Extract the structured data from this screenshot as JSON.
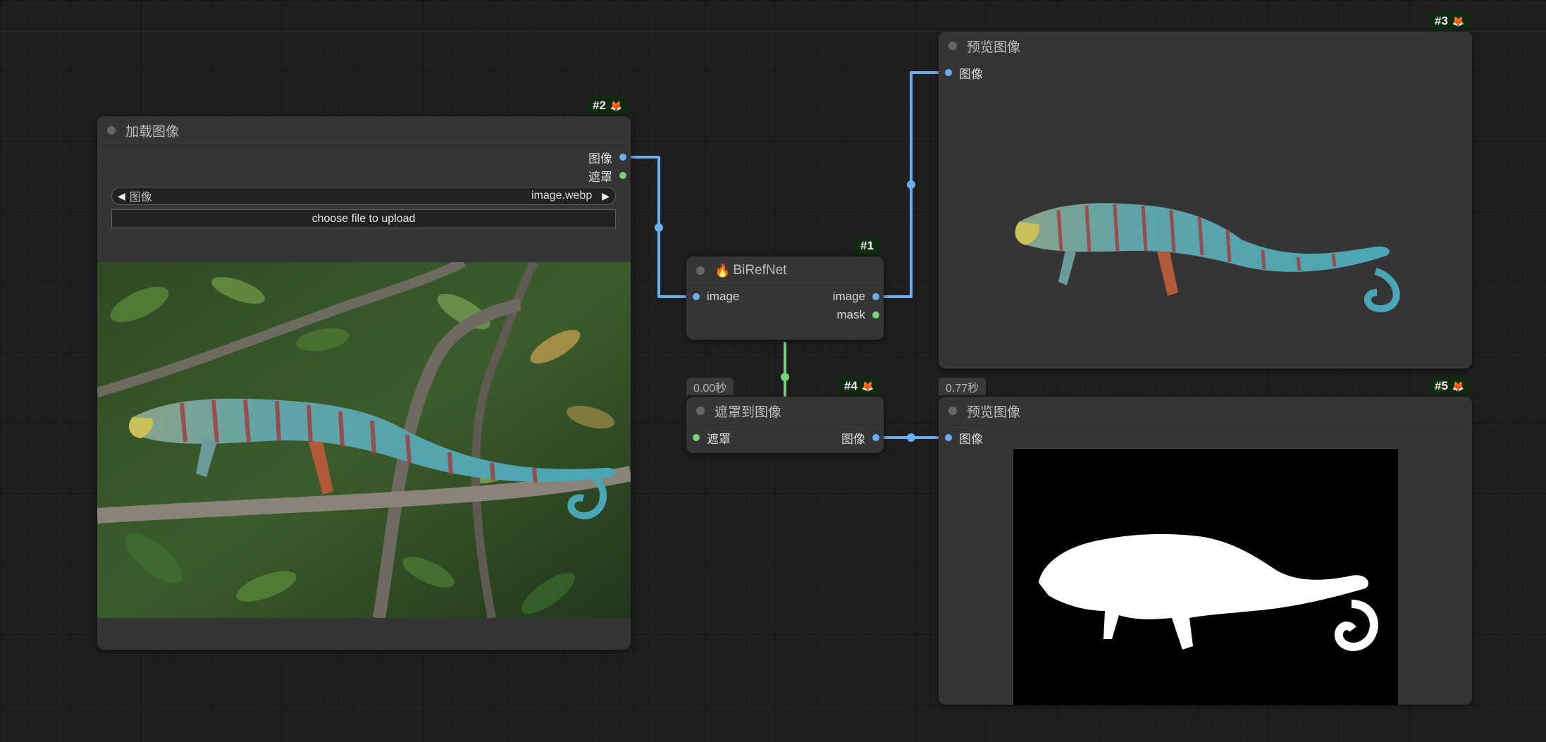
{
  "nodes": {
    "load_image": {
      "id_badge": "#2",
      "title": "加载图像",
      "outputs": [
        "图像",
        "遮罩"
      ],
      "combo_label": "图像",
      "combo_value": "image.webp",
      "upload_label": "choose file to upload"
    },
    "birefnet": {
      "id_badge": "#1",
      "title": "BiRefNet",
      "input": "image",
      "outputs": [
        "image",
        "mask"
      ]
    },
    "mask_to_image": {
      "id_badge": "#4",
      "time": "0.00秒",
      "title": "遮罩到图像",
      "input": "遮罩",
      "output": "图像"
    },
    "preview_top": {
      "id_badge": "#3",
      "title": "预览图像",
      "input": "图像"
    },
    "preview_bottom": {
      "id_badge": "#5",
      "time": "0.77秒",
      "title": "预览图像",
      "input": "图像"
    }
  },
  "icons": {
    "fire": "fire-icon",
    "badge": "fox-icon"
  },
  "colors": {
    "image_link": "#6ab0f0",
    "mask_link": "#7bd17b",
    "canvas": "#1f1f1f",
    "node": "#353535"
  }
}
